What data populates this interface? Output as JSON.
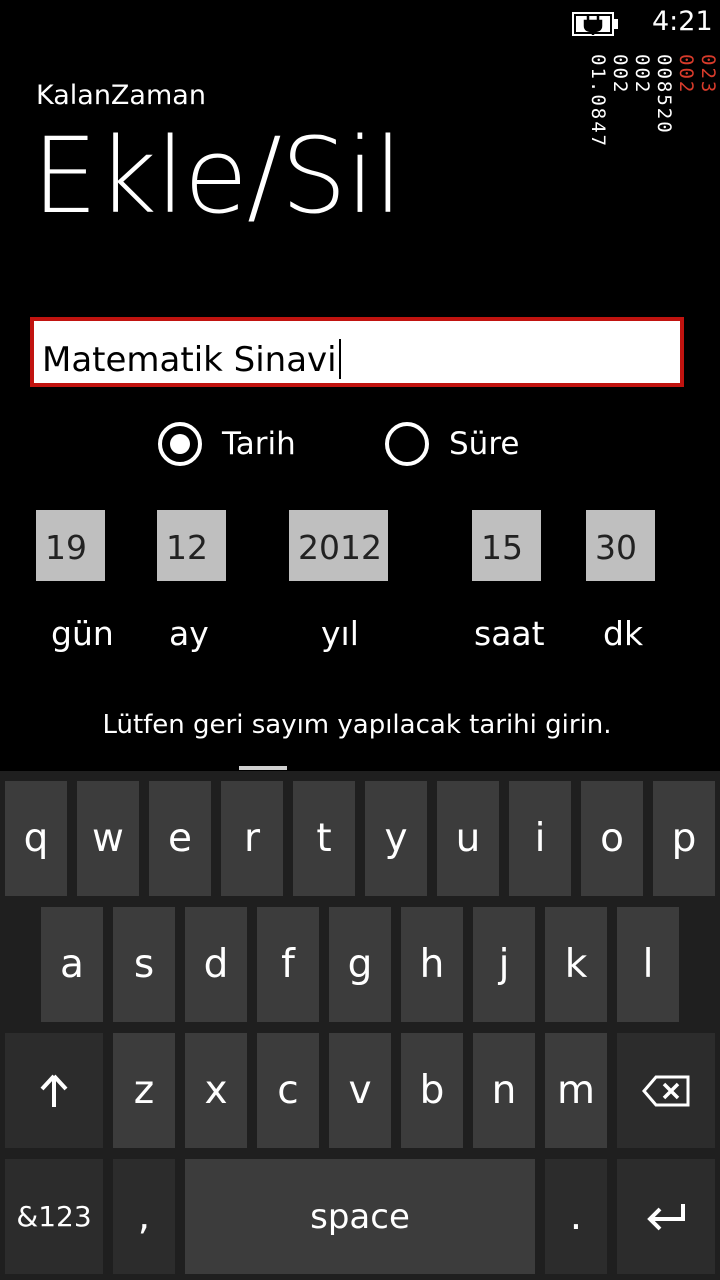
{
  "status_bar": {
    "time": "4:21",
    "battery_icon": "battery-charging-icon"
  },
  "debug_counters": [
    "023",
    "002",
    "008520",
    "002",
    "002",
    "01.0847"
  ],
  "app": {
    "name": "KalanZaman",
    "title": "Ekle/Sil"
  },
  "name_input": {
    "value": "Matematik Sinavi"
  },
  "mode": {
    "options": [
      "Tarih",
      "Süre"
    ],
    "selected": "Tarih"
  },
  "date_fields": [
    {
      "value": "19",
      "label": "gün"
    },
    {
      "value": "12",
      "label": "ay"
    },
    {
      "value": "2012",
      "label": "yıl"
    },
    {
      "value": "15",
      "label": "saat"
    },
    {
      "value": "30",
      "label": "dk"
    }
  ],
  "hint": "Lütfen geri sayım yapılacak tarihi girin.",
  "keyboard": {
    "row1": [
      "q",
      "w",
      "e",
      "r",
      "t",
      "y",
      "u",
      "i",
      "o",
      "p"
    ],
    "row2": [
      "a",
      "s",
      "d",
      "f",
      "g",
      "h",
      "j",
      "k",
      "l"
    ],
    "row3": [
      "z",
      "x",
      "c",
      "v",
      "b",
      "n",
      "m"
    ],
    "shift_icon": "shift-arrow-up-icon",
    "backspace_icon": "backspace-icon",
    "enter_icon": "enter-icon",
    "symbols_label": "&123",
    "comma_label": ",",
    "space_label": "space",
    "period_label": "."
  },
  "colors": {
    "background": "#000000",
    "accent": "#c1130f",
    "field_bg": "#bfbfbf",
    "key_bg": "#3c3c3c"
  }
}
